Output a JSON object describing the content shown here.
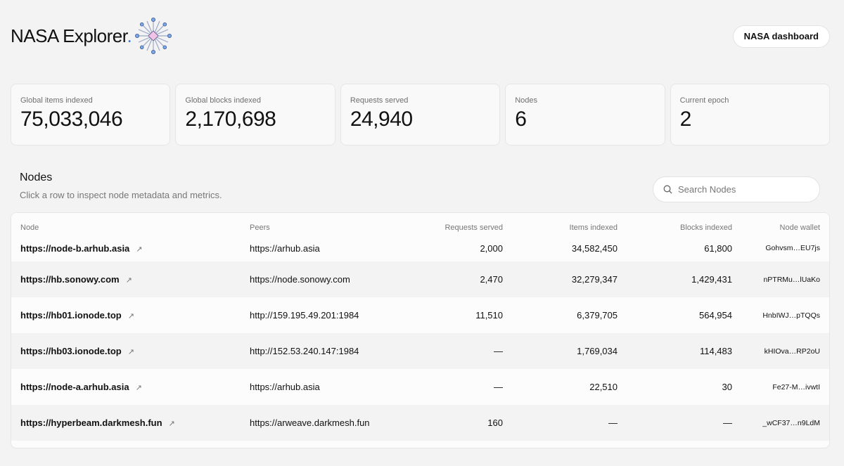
{
  "header": {
    "brand": "NASA Explorer",
    "brand_dot": ".",
    "dashboard_button": "NASA dashboard"
  },
  "stats": [
    {
      "label": "Global items indexed",
      "value": "75,033,046"
    },
    {
      "label": "Global blocks indexed",
      "value": "2,170,698"
    },
    {
      "label": "Requests served",
      "value": "24,940"
    },
    {
      "label": "Nodes",
      "value": "6"
    },
    {
      "label": "Current epoch",
      "value": "2"
    }
  ],
  "nodes_section": {
    "title": "Nodes",
    "subtitle": "Click a row to inspect node metadata and metrics.",
    "search_placeholder": "Search Nodes"
  },
  "table": {
    "headers": {
      "node": "Node",
      "peers": "Peers",
      "requests": "Requests served",
      "items": "Items indexed",
      "blocks": "Blocks indexed",
      "wallet": "Node wallet"
    },
    "rows": [
      {
        "node": "https://node-b.arhub.asia",
        "peers": "https://arhub.asia",
        "requests": "2,000",
        "items": "34,582,450",
        "blocks": "61,800",
        "wallet": "Gohvsm…EU7js"
      },
      {
        "node": "https://hb.sonowy.com",
        "peers": "https://node.sonowy.com",
        "requests": "2,470",
        "items": "32,279,347",
        "blocks": "1,429,431",
        "wallet": "nPTRMu…lUaKo"
      },
      {
        "node": "https://hb01.ionode.top",
        "peers": "http://159.195.49.201:1984",
        "requests": "11,510",
        "items": "6,379,705",
        "blocks": "564,954",
        "wallet": "HnbIWJ…pTQQs"
      },
      {
        "node": "https://hb03.ionode.top",
        "peers": "http://152.53.240.147:1984",
        "requests": "—",
        "items": "1,769,034",
        "blocks": "114,483",
        "wallet": "kHIOva…RP2oU"
      },
      {
        "node": "https://node-a.arhub.asia",
        "peers": "https://arhub.asia",
        "requests": "—",
        "items": "22,510",
        "blocks": "30",
        "wallet": "Fe27-M…ivwtI"
      },
      {
        "node": "https://hyperbeam.darkmesh.fun",
        "peers": "https://arweave.darkmesh.fun",
        "requests": "160",
        "items": "—",
        "blocks": "—",
        "wallet": "_wCF37…n9LdM"
      }
    ]
  },
  "icons": {
    "brand": "snowflake-network-icon",
    "search": "search-icon",
    "external_link": "external-link-icon",
    "external_link_glyph": "↗"
  },
  "colors": {
    "background": "#f3f3f3",
    "accent": "#3a7bd5",
    "card": "#f9f9f9"
  }
}
